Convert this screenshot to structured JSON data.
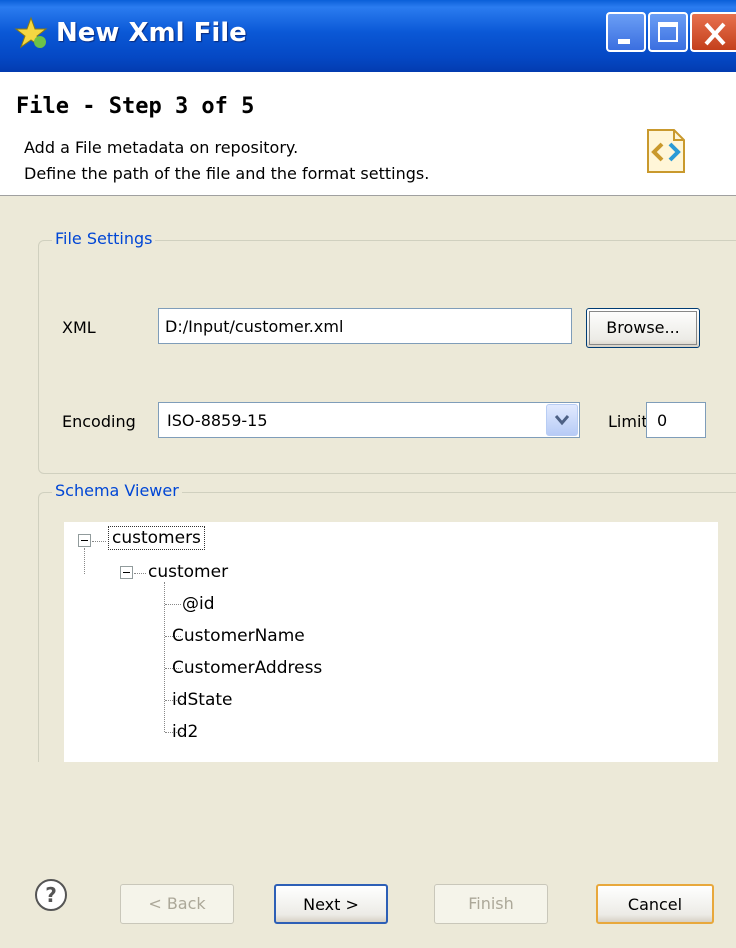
{
  "window": {
    "title": "New Xml File"
  },
  "header": {
    "step_title": "File - Step 3 of 5",
    "desc1": "Add a File metadata on repository.",
    "desc2": "Define the path of the file and the format settings."
  },
  "file_settings": {
    "title": "File Settings",
    "xml_label": "XML",
    "xml_value": "D:/Input/customer.xml",
    "browse_label": "Browse...",
    "encoding_label": "Encoding",
    "encoding_value": "ISO-8859-15",
    "limit_label": "Limit",
    "limit_value": "0"
  },
  "schema_viewer": {
    "title": "Schema Viewer",
    "root": "customers",
    "child": "customer",
    "leaves": [
      "@id",
      "CustomerName",
      "CustomerAddress",
      "idState",
      "id2"
    ]
  },
  "buttons": {
    "back": "< Back",
    "next": "Next >",
    "finish": "Finish",
    "cancel": "Cancel"
  },
  "colors": {
    "titlebar": "#0a58d6",
    "group_title": "#0046d5",
    "dialog_bg": "#ece9d8"
  }
}
